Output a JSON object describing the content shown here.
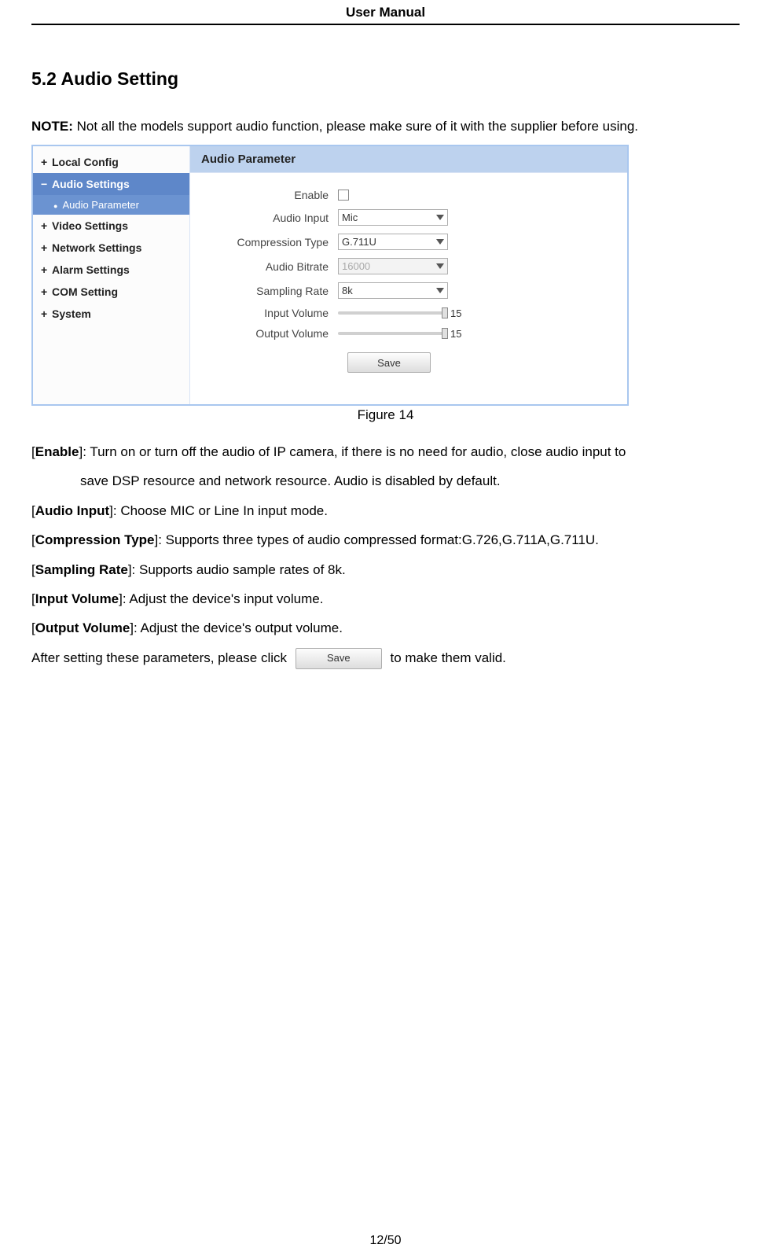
{
  "header": "User Manual",
  "section_title": "5.2 Audio Setting",
  "note_label": "NOTE:",
  "note_text": " Not all the models support audio function, please make sure of it with the supplier before using.",
  "sidebar": {
    "items": [
      {
        "sign": "+",
        "label": "Local Config"
      },
      {
        "sign": "−",
        "label": "Audio Settings"
      },
      {
        "sign": "+",
        "label": "Video Settings"
      },
      {
        "sign": "+",
        "label": "Network Settings"
      },
      {
        "sign": "+",
        "label": "Alarm Settings"
      },
      {
        "sign": "+",
        "label": "COM Setting"
      },
      {
        "sign": "+",
        "label": "System"
      }
    ],
    "sub_item": "Audio Parameter"
  },
  "panel_title": "Audio Parameter",
  "form": {
    "enable_label": "Enable",
    "audio_input_label": "Audio Input",
    "audio_input_value": "Mic",
    "compression_label": "Compression Type",
    "compression_value": "G.711U",
    "bitrate_label": "Audio Bitrate",
    "bitrate_value": "16000",
    "sampling_label": "Sampling Rate",
    "sampling_value": "8k",
    "input_volume_label": "Input Volume",
    "input_volume_value": "15",
    "output_volume_label": "Output Volume",
    "output_volume_value": "15",
    "save_label": "Save"
  },
  "figure_caption": "Figure 14",
  "descriptions": {
    "enable_key": "Enable",
    "enable_text": "]: Turn on or turn off the audio of IP camera, if there is no need for audio, close audio input to",
    "enable_text2": "save DSP resource and network resource. Audio is disabled by default.",
    "audio_input_key": "Audio Input",
    "audio_input_text": "]: Choose MIC or Line In input mode.",
    "compression_key": "Compression Type",
    "compression_text": "]: Supports three types of audio compressed format:G.726,G.711A,G.711U.",
    "sampling_key": "Sampling Rate",
    "sampling_text": "]: Supports audio sample rates of 8k.",
    "input_volume_key": "Input Volume",
    "input_volume_text": "]: Adjust the device's input volume.",
    "output_volume_key": "Output Volume",
    "output_volume_text": "]: Adjust the device's output volume.",
    "after_text1": "After setting these parameters, please click ",
    "after_button": "Save",
    "after_text2": " to make them valid."
  },
  "pager": "12/50"
}
